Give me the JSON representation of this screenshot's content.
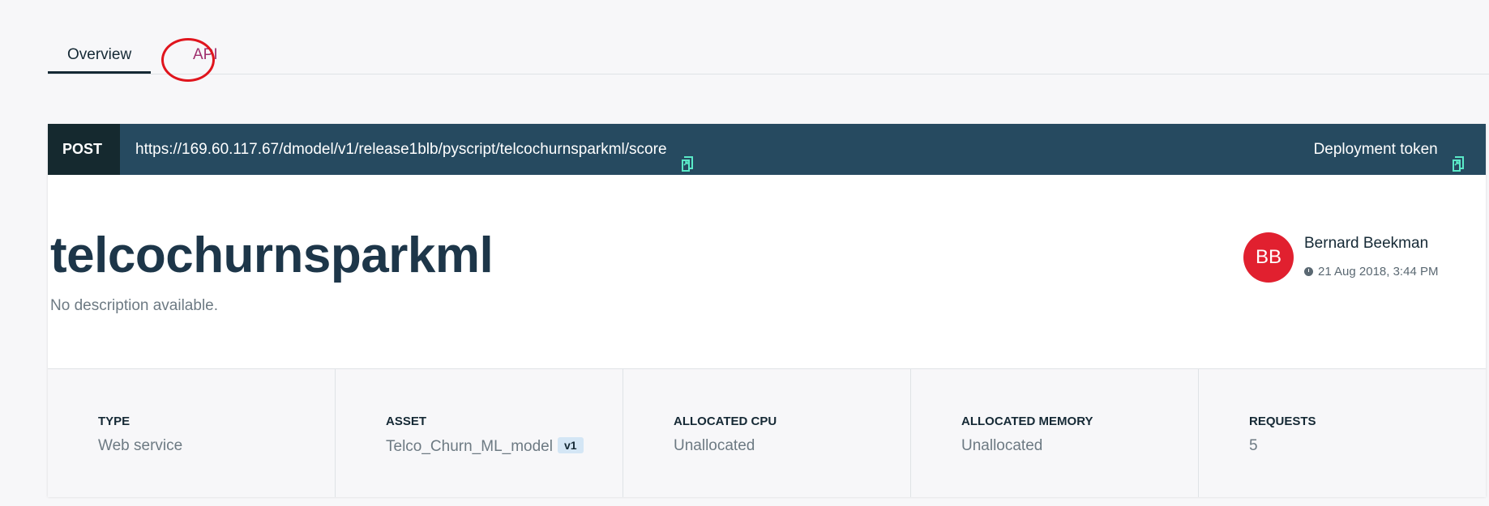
{
  "tabs": [
    {
      "label": "Overview",
      "active": true
    },
    {
      "label": "API",
      "active": false
    }
  ],
  "endpoint": {
    "method": "POST",
    "url": "https://169.60.117.67/dmodel/v1/release1blb/pyscript/telcochurnsparkml/score",
    "token_label": "Deployment token"
  },
  "model": {
    "name": "telcochurnsparkml",
    "description": "No description available."
  },
  "owner": {
    "initials": "BB",
    "name": "Bernard Beekman",
    "timestamp": "21 Aug 2018, 3:44 PM"
  },
  "stats": {
    "type": {
      "label": "TYPE",
      "value": "Web service"
    },
    "asset": {
      "label": "ASSET",
      "value": "Telco_Churn_ML_model",
      "version": "v1"
    },
    "cpu": {
      "label": "ALLOCATED CPU",
      "value": "Unallocated"
    },
    "memory": {
      "label": "ALLOCATED MEMORY",
      "value": "Unallocated"
    },
    "requests": {
      "label": "REQUESTS",
      "value": "5"
    }
  },
  "colors": {
    "endpoint_bar": "#264a60",
    "method_bg": "#15292f",
    "avatar": "#e1202f",
    "copy_icon": "#5aeac8",
    "api_tab": "#a0306e",
    "annotation": "#e0151d"
  },
  "icons": {
    "copy": "copy-icon",
    "clock": "clock-icon"
  }
}
